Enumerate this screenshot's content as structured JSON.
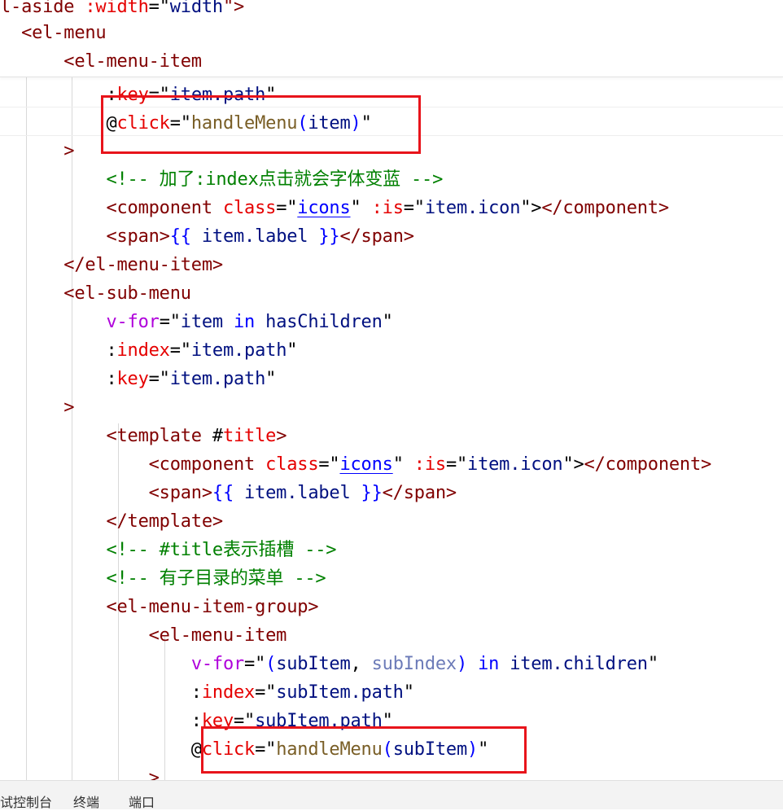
{
  "colors": {
    "tag": "#800000",
    "attr": "#e50000",
    "directive": "#af00db",
    "keyword": "#0000ff",
    "string": "#a31515",
    "value": "#001080",
    "function": "#795e26",
    "comment": "#008000",
    "text": "#000000",
    "variable_dim": "#6c7bb8",
    "highlight_box": "#e8141b"
  },
  "editor": {
    "lines": [
      [
        {
          "t": "l-aside ",
          "c": "tag"
        },
        {
          "t": ":width",
          "c": "attr"
        },
        {
          "t": "=\"",
          "c": "text"
        },
        {
          "t": "width",
          "c": "value"
        },
        {
          "t": "\">",
          "c": "tag"
        }
      ],
      [
        {
          "t": "  <el-menu",
          "c": "tag"
        }
      ],
      [
        {
          "t": "      <el-menu-item",
          "c": "tag"
        }
      ],
      [
        {
          "t": "          :",
          "c": "text"
        },
        {
          "t": "key",
          "c": "attr"
        },
        {
          "t": "=\"",
          "c": "text"
        },
        {
          "t": "item.path",
          "c": "value"
        },
        {
          "t": "\"",
          "c": "text"
        }
      ],
      [
        {
          "t": "          @",
          "c": "text"
        },
        {
          "t": "click",
          "c": "attr"
        },
        {
          "t": "=\"",
          "c": "text"
        },
        {
          "t": "handleMenu",
          "c": "function"
        },
        {
          "t": "(",
          "c": "keyword"
        },
        {
          "t": "item",
          "c": "value"
        },
        {
          "t": ")",
          "c": "keyword"
        },
        {
          "t": "\"",
          "c": "text"
        }
      ],
      [
        {
          "t": "      >",
          "c": "tag"
        }
      ],
      [
        {
          "t": "          <!-- 加了:index点击就会字体变蓝 -->",
          "c": "comment"
        }
      ],
      [
        {
          "t": "          <component ",
          "c": "tag"
        },
        {
          "t": "class",
          "c": "attr"
        },
        {
          "t": "=\"",
          "c": "text"
        },
        {
          "t": "icons",
          "c": "keyword",
          "u": true
        },
        {
          "t": "\" ",
          "c": "text"
        },
        {
          "t": ":is",
          "c": "attr"
        },
        {
          "t": "=\"",
          "c": "text"
        },
        {
          "t": "item.icon",
          "c": "value"
        },
        {
          "t": "\">",
          "c": "text"
        },
        {
          "t": "</component>",
          "c": "tag"
        }
      ],
      [
        {
          "t": "          <span>",
          "c": "tag"
        },
        {
          "t": "{{ ",
          "c": "keyword"
        },
        {
          "t": "item.label",
          "c": "value"
        },
        {
          "t": " }}",
          "c": "keyword"
        },
        {
          "t": "</span>",
          "c": "tag"
        }
      ],
      [
        {
          "t": "      </el-menu-item>",
          "c": "tag"
        }
      ],
      [
        {
          "t": "      <el-sub-menu",
          "c": "tag"
        }
      ],
      [
        {
          "t": "          ",
          "c": "text"
        },
        {
          "t": "v-for",
          "c": "directive"
        },
        {
          "t": "=\"",
          "c": "text"
        },
        {
          "t": "item",
          "c": "value"
        },
        {
          "t": " in ",
          "c": "keyword"
        },
        {
          "t": "hasChildren",
          "c": "value"
        },
        {
          "t": "\"",
          "c": "text"
        }
      ],
      [
        {
          "t": "          :",
          "c": "text"
        },
        {
          "t": "index",
          "c": "attr"
        },
        {
          "t": "=\"",
          "c": "text"
        },
        {
          "t": "item.path",
          "c": "value"
        },
        {
          "t": "\"",
          "c": "text"
        }
      ],
      [
        {
          "t": "          :",
          "c": "text"
        },
        {
          "t": "key",
          "c": "attr"
        },
        {
          "t": "=\"",
          "c": "text"
        },
        {
          "t": "item.path",
          "c": "value"
        },
        {
          "t": "\"",
          "c": "text"
        }
      ],
      [
        {
          "t": "      >",
          "c": "tag"
        }
      ],
      [
        {
          "t": "          <template ",
          "c": "tag"
        },
        {
          "t": "#",
          "c": "text"
        },
        {
          "t": "title",
          "c": "attr"
        },
        {
          "t": ">",
          "c": "tag"
        }
      ],
      [
        {
          "t": "              <component ",
          "c": "tag"
        },
        {
          "t": "class",
          "c": "attr"
        },
        {
          "t": "=\"",
          "c": "text"
        },
        {
          "t": "icons",
          "c": "keyword",
          "u": true
        },
        {
          "t": "\" ",
          "c": "text"
        },
        {
          "t": ":is",
          "c": "attr"
        },
        {
          "t": "=\"",
          "c": "text"
        },
        {
          "t": "item.icon",
          "c": "value"
        },
        {
          "t": "\">",
          "c": "text"
        },
        {
          "t": "</component>",
          "c": "tag"
        }
      ],
      [
        {
          "t": "              <span>",
          "c": "tag"
        },
        {
          "t": "{{ ",
          "c": "keyword"
        },
        {
          "t": "item.label",
          "c": "value"
        },
        {
          "t": " }}",
          "c": "keyword"
        },
        {
          "t": "</span>",
          "c": "tag"
        }
      ],
      [
        {
          "t": "          </template>",
          "c": "tag"
        }
      ],
      [
        {
          "t": "          <!-- #title表示插槽 -->",
          "c": "comment"
        }
      ],
      [
        {
          "t": "          <!-- 有子目录的菜单 -->",
          "c": "comment"
        }
      ],
      [
        {
          "t": "          <el-menu-item-group>",
          "c": "tag"
        }
      ],
      [
        {
          "t": "              <el-menu-item",
          "c": "tag"
        }
      ],
      [
        {
          "t": "                  ",
          "c": "text"
        },
        {
          "t": "v-for",
          "c": "directive"
        },
        {
          "t": "=\"",
          "c": "text"
        },
        {
          "t": "(",
          "c": "keyword"
        },
        {
          "t": "subItem",
          "c": "value"
        },
        {
          "t": ", ",
          "c": "text"
        },
        {
          "t": "subIndex",
          "c": "variable_dim"
        },
        {
          "t": ")",
          "c": "keyword"
        },
        {
          "t": " in ",
          "c": "keyword"
        },
        {
          "t": "item.children",
          "c": "value"
        },
        {
          "t": "\"",
          "c": "text"
        }
      ],
      [
        {
          "t": "                  :",
          "c": "text"
        },
        {
          "t": "index",
          "c": "attr"
        },
        {
          "t": "=\"",
          "c": "text"
        },
        {
          "t": "subItem.path",
          "c": "value"
        },
        {
          "t": "\"",
          "c": "text"
        }
      ],
      [
        {
          "t": "                  :",
          "c": "text"
        },
        {
          "t": "key",
          "c": "attr"
        },
        {
          "t": "=\"",
          "c": "text"
        },
        {
          "t": "subItem.path",
          "c": "value"
        },
        {
          "t": "\"",
          "c": "text"
        }
      ],
      [
        {
          "t": "                  @",
          "c": "text"
        },
        {
          "t": "click",
          "c": "attr"
        },
        {
          "t": "=\"",
          "c": "text"
        },
        {
          "t": "handleMenu",
          "c": "function"
        },
        {
          "t": "(",
          "c": "keyword"
        },
        {
          "t": "subItem",
          "c": "value"
        },
        {
          "t": ")",
          "c": "keyword"
        },
        {
          "t": "\"",
          "c": "text"
        }
      ],
      [
        {
          "t": "              >",
          "c": "tag"
        }
      ]
    ]
  },
  "bottom_panel": {
    "tabs": [
      "试控制台",
      "终端",
      "端口"
    ]
  }
}
